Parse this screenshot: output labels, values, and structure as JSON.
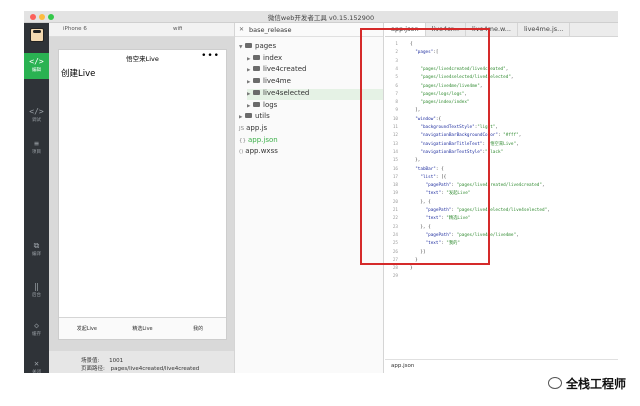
{
  "window": {
    "title": "微信web开发者工具 v0.15.152900"
  },
  "leftbar": {
    "items": [
      {
        "icon": "</>",
        "label": "编辑",
        "active": true
      },
      {
        "icon": "</>",
        "label": "调试"
      },
      {
        "icon": "≡",
        "label": "项目"
      },
      {
        "icon": "⧉",
        "label": "编译"
      },
      {
        "icon": "‖",
        "label": "后台"
      },
      {
        "icon": "◇",
        "label": "缓存"
      },
      {
        "icon": "✕",
        "label": "关闭"
      }
    ]
  },
  "simulator": {
    "device": "iPhone 6",
    "network": "wifi",
    "nav_title": "悟空来Live",
    "menu_dots": "•••",
    "content_text": "创建Live",
    "tabs": [
      "发起Live",
      "精选Live",
      "我的"
    ],
    "scene_label": "场景值:",
    "scene_value": "1001",
    "path_label": "页面路径:",
    "path_value": "pages/live4created/live4created"
  },
  "tree": {
    "project": "base_release",
    "nodes": [
      {
        "type": "folder",
        "name": "pages",
        "open": true,
        "depth": 0
      },
      {
        "type": "folder",
        "name": "index",
        "depth": 1
      },
      {
        "type": "folder",
        "name": "live4created",
        "depth": 1
      },
      {
        "type": "folder",
        "name": "live4me",
        "depth": 1
      },
      {
        "type": "folder",
        "name": "live4selected",
        "depth": 1,
        "selected": true
      },
      {
        "type": "folder",
        "name": "logs",
        "depth": 1
      },
      {
        "type": "folder",
        "name": "utils",
        "depth": 0
      },
      {
        "type": "file",
        "ext": "JS",
        "name": "app.js",
        "depth": 0
      },
      {
        "type": "file",
        "ext": "{}",
        "name": "app.json",
        "depth": 0,
        "green": true
      },
      {
        "type": "file",
        "ext": "()",
        "name": "app.wxss",
        "depth": 0
      }
    ]
  },
  "editor": {
    "tabs": [
      "app.json",
      "live4cr...",
      "live4me.w...",
      "live4me.js..."
    ],
    "active_tab": 0,
    "file_name": "app.json",
    "lines": [
      "{",
      "  \"pages\":[",
      "",
      "    \"pages/live4created/live4created\",",
      "    \"pages/live4selected/live4selected\",",
      "    \"pages/live4me/live4me\",",
      "    \"pages/logs/logs\",",
      "    \"pages/index/index\"",
      "  ],",
      "  \"window\":{",
      "    \"backgroundTextStyle\":\"light\",",
      "    \"navigationBarBackgroundColor\": \"#fff\",",
      "    \"navigationBarTitleText\": \"悟空来Live\",",
      "    \"navigationBarTextStyle\":\"black\"",
      "  },",
      "  \"tabBar\": {",
      "    \"list\": [{",
      "      \"pagePath\": \"pages/live4created/live4created\",",
      "      \"text\": \"发起Live\"",
      "    }, {",
      "      \"pagePath\": \"pages/live4selected/live4selected\",",
      "      \"text\": \"精选Live\"",
      "    }, {",
      "      \"pagePath\": \"pages/live4me/live4me\",",
      "      \"text\": \"我的\"",
      "    }]",
      "  }",
      "}",
      ""
    ]
  },
  "watermark": {
    "text": "全栈工程师"
  },
  "colors": {
    "accent": "#2ab252",
    "highlight": "#d52a2a",
    "sidebar": "#2f3338"
  }
}
